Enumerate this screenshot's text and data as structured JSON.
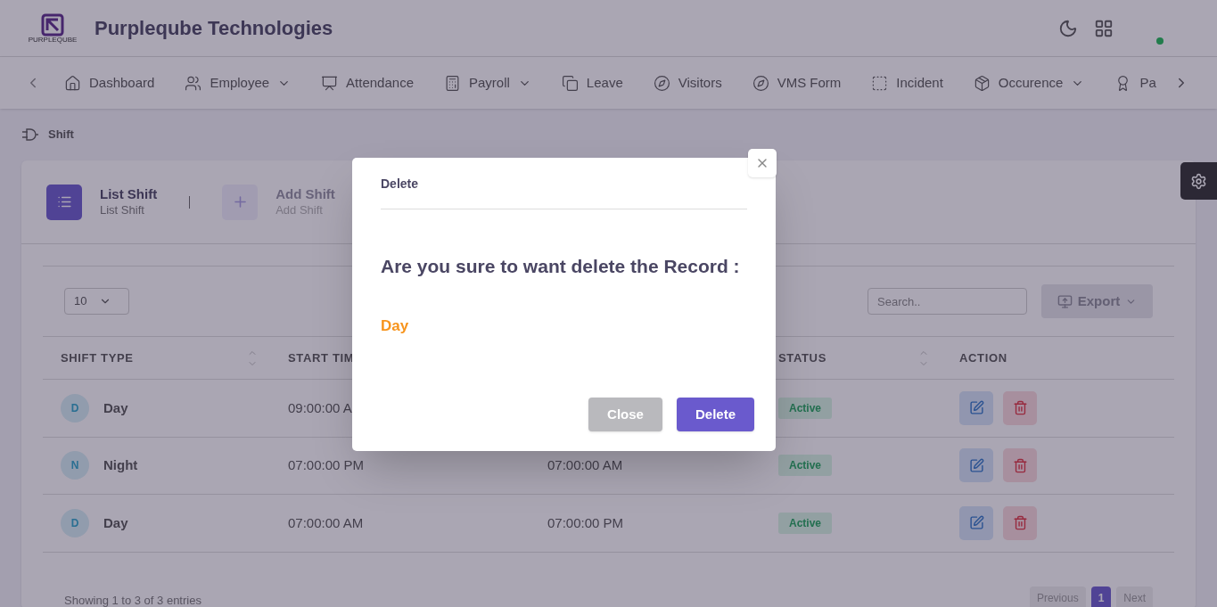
{
  "header": {
    "logo_text": "PURPLEQUBE",
    "company": "Purpleqube Technologies",
    "online": true
  },
  "nav": [
    {
      "label": "Dashboard",
      "has_menu": false
    },
    {
      "label": "Employee",
      "has_menu": true
    },
    {
      "label": "Attendance",
      "has_menu": false
    },
    {
      "label": "Payroll",
      "has_menu": true
    },
    {
      "label": "Leave",
      "has_menu": false
    },
    {
      "label": "Visitors",
      "has_menu": false
    },
    {
      "label": "VMS Form",
      "has_menu": false
    },
    {
      "label": "Incident",
      "has_menu": false
    },
    {
      "label": "Occurence",
      "has_menu": true
    },
    {
      "label": "Pa",
      "has_menu": false
    }
  ],
  "breadcrumb": "Shift",
  "tabs": [
    {
      "title": "List Shift",
      "subtitle": "List Shift",
      "selected": true
    },
    {
      "title": "Add Shift",
      "subtitle": "Add Shift",
      "selected": false
    }
  ],
  "page_size": "10",
  "search": {
    "placeholder": "Search.."
  },
  "export": "Export",
  "columns": [
    {
      "label": "SHIFT TYPE",
      "sortable": true
    },
    {
      "label": "START TIM"
    },
    {
      "label": "STATUS",
      "sortable": true
    },
    {
      "label": "ACTION",
      "sortable": false
    }
  ],
  "rows": [
    {
      "initial": "D",
      "shift_type": "Day",
      "start_time": "09:00:00 A",
      "status": "Active"
    },
    {
      "initial": "N",
      "shift_type": "Night",
      "start_time": "07:00:00 PM",
      "end_time": "07:00:00 AM",
      "status": "Active"
    },
    {
      "initial": "D",
      "shift_type": "Day",
      "start_time": "07:00:00 AM",
      "end_time": "07:00:00 PM",
      "status": "Active"
    }
  ],
  "footer": "Showing 1 to 3 of 3 entries",
  "pagination": [
    {
      "label": "Previous",
      "selected": false
    },
    {
      "label": "1",
      "selected": true
    },
    {
      "label": "Next",
      "selected": false
    }
  ],
  "modal": {
    "title": "Delete",
    "message": "Are you sure to want delete the Record :",
    "record": "Day",
    "buttons": [
      {
        "label": "Close",
        "kind": "secondary"
      },
      {
        "label": "Delete",
        "kind": "primary"
      }
    ]
  }
}
